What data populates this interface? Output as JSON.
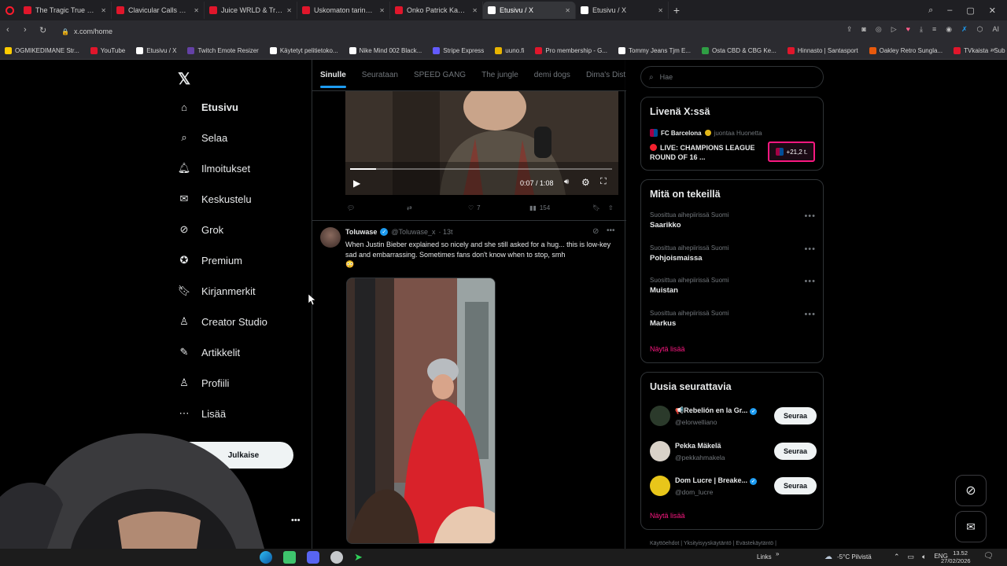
{
  "browser": {
    "tabs": [
      {
        "label": "The Tragic True Story of Ju",
        "color": "#e0162b"
      },
      {
        "label": "Clavicular Calls Out Larry",
        "color": "#e0162b"
      },
      {
        "label": "Juice WRLD & Travis Scott",
        "color": "#e0162b"
      },
      {
        "label": "Uskomaton tarina sinnikk",
        "color": "#e0162b"
      },
      {
        "label": "Onko Patrick Kane kaikkie",
        "color": "#e0162b"
      },
      {
        "label": "Etusivu / X",
        "color": "#ffffff"
      },
      {
        "label": "Etusivu / X",
        "color": "#ffffff"
      }
    ],
    "url": "x.com/home",
    "bookmarks": [
      {
        "label": "OGMIKEDIMANE Str...",
        "color": "#ffcc00"
      },
      {
        "label": "YouTube",
        "color": "#e0162b"
      },
      {
        "label": "Etusivu / X",
        "color": "#ffffff"
      },
      {
        "label": "Twitch Emote Resizer",
        "color": "#6441a5"
      },
      {
        "label": "Käytetyt pelitietoko...",
        "color": "#ffffff"
      },
      {
        "label": "Nike Mind 002 Black...",
        "color": "#ffffff"
      },
      {
        "label": "Stripe Express",
        "color": "#635bff"
      },
      {
        "label": "uuno.fi",
        "color": "#e8b400"
      },
      {
        "label": "Pro membership - G...",
        "color": "#e0162b"
      },
      {
        "label": "Tommy Jeans Tjm E...",
        "color": "#ffffff"
      },
      {
        "label": "Osta CBD & CBG Ke...",
        "color": "#2f9e44"
      },
      {
        "label": "Hinnasto | Santasport",
        "color": "#e0162b"
      },
      {
        "label": "Oakley Retro Sungla...",
        "color": "#e8590c"
      },
      {
        "label": "TVkaista - Sub Suora",
        "color": "#e0162b"
      }
    ]
  },
  "sidebar": {
    "items": [
      {
        "label": "Etusivu",
        "icon": "home-icon"
      },
      {
        "label": "Selaa",
        "icon": "search-icon"
      },
      {
        "label": "Ilmoitukset",
        "icon": "bell-icon"
      },
      {
        "label": "Keskustelu",
        "icon": "mail-icon"
      },
      {
        "label": "Grok",
        "icon": "grok-icon"
      },
      {
        "label": "Premium",
        "icon": "premium-icon"
      },
      {
        "label": "Kirjanmerkit",
        "icon": "bookmark-icon"
      },
      {
        "label": "Creator Studio",
        "icon": "creator-icon"
      },
      {
        "label": "Artikkelit",
        "icon": "article-icon"
      },
      {
        "label": "Profiili",
        "icon": "profile-icon"
      },
      {
        "label": "Lisää",
        "icon": "more-icon"
      }
    ],
    "post_button": "Julkaise"
  },
  "feed": {
    "tabs": [
      "Sinulle",
      "Seurataan",
      "SPEED GANG",
      "The jungle",
      "demi dogs",
      "Dima's Dist"
    ],
    "video": {
      "time": "0:07 / 1:08",
      "progress": 0.1
    },
    "tweet1_stats": {
      "likes": "7",
      "views": "154"
    },
    "tweet2": {
      "name": "Toluwase",
      "handle": "@Toluwase_x",
      "time": "· 13t",
      "text": "When Justin Bieber explained so nicely and she still asked for a hug... this is low-key sad and embarrassing. Sometimes fans don't know when to stop, smh",
      "emoji": "😳"
    }
  },
  "right": {
    "search_placeholder": "Hae",
    "live": {
      "title": "Livenä X:ssä",
      "account": "FC Barcelona",
      "host_text": "juontaa Huonetta",
      "event": "LIVE: CHAMPIONS LEAGUE ROUND OF 16 ...",
      "badge": "+21,2 t."
    },
    "trends": {
      "title": "Mitä on tekeillä",
      "items": [
        {
          "meta": "Suosittua aihepiirissä Suomi",
          "name": "Saarikko"
        },
        {
          "meta": "Suosittua aihepiirissä Suomi",
          "name": "Pohjoismaissa"
        },
        {
          "meta": "Suosittua aihepiirissä Suomi",
          "name": "Muistan"
        },
        {
          "meta": "Suosittua aihepiirissä Suomi",
          "name": "Markus"
        }
      ],
      "more": "Näytä lisää"
    },
    "follow": {
      "title": "Uusia seurattavia",
      "items": [
        {
          "name": "📢Rebelión en la Gr...",
          "handle": "@elorwelliano",
          "button": "Seuraa"
        },
        {
          "name": "Pekka Mäkelä",
          "handle": "@pekkahmakela",
          "button": "Seuraa"
        },
        {
          "name": "Dom Lucre | Breake...",
          "handle": "@dom_lucre",
          "button": "Seuraa"
        }
      ],
      "more": "Näytä lisää"
    },
    "footer_links": "Käyttöehdot | Yksityisyyskäytäntö | Evästekäytäntö |"
  },
  "taskbar": {
    "links": "Links",
    "weather": "-5°C Pilvistä",
    "lang": "ENG",
    "time": "13.52",
    "date": "27/02/2026"
  }
}
